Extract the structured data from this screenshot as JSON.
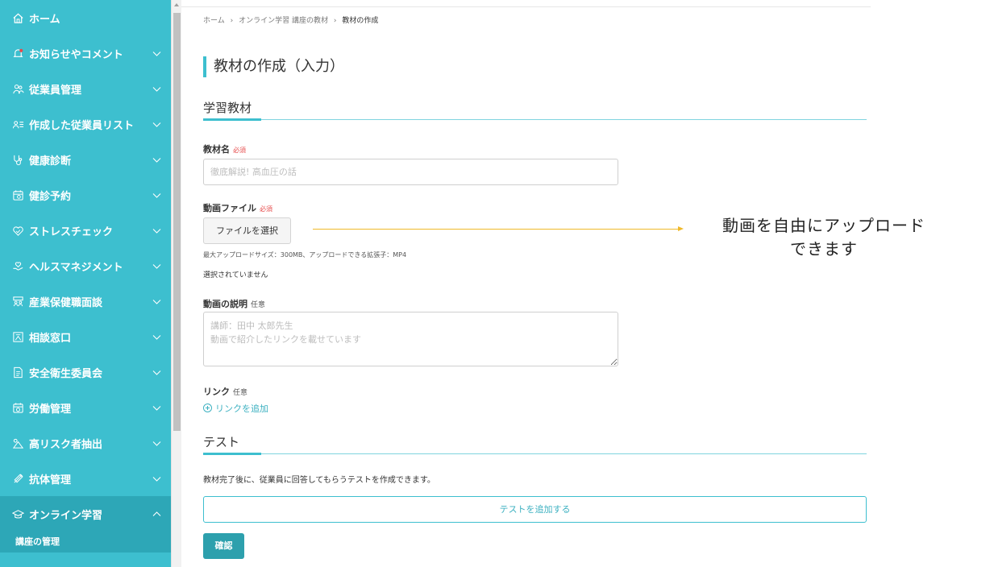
{
  "sidebar": {
    "items": [
      {
        "label": "ホーム",
        "icon": "home-icon"
      },
      {
        "label": "お知らせやコメント",
        "icon": "bell-icon"
      },
      {
        "label": "従業員管理",
        "icon": "people-icon"
      },
      {
        "label": "作成した従業員リスト",
        "icon": "person-list-icon"
      },
      {
        "label": "健康診断",
        "icon": "stethoscope-icon"
      },
      {
        "label": "健診予約",
        "icon": "calendar-icon"
      },
      {
        "label": "ストレスチェック",
        "icon": "heart-check-icon"
      },
      {
        "label": "ヘルスマネジメント",
        "icon": "hand-heart-icon"
      },
      {
        "label": "産業保健職面談",
        "icon": "meeting-icon"
      },
      {
        "label": "相談窓口",
        "icon": "consult-icon"
      },
      {
        "label": "安全衛生委員会",
        "icon": "document-icon"
      },
      {
        "label": "労働管理",
        "icon": "calendar-clock-icon"
      },
      {
        "label": "高リスク者抽出",
        "icon": "risk-icon"
      },
      {
        "label": "抗体管理",
        "icon": "syringe-icon"
      },
      {
        "label": "オンライン学習",
        "icon": "graduation-cap-icon"
      }
    ],
    "sub_item": "講座の管理"
  },
  "breadcrumb": {
    "home": "ホーム",
    "sep": "›",
    "parent": "オンライン学習 講座の教材",
    "current": "教材の作成"
  },
  "page_title": "教材の作成（入力）",
  "section_material": "学習教材",
  "fields": {
    "name_label": "教材名",
    "required": "必須",
    "optional": "任意",
    "name_placeholder": "徹底解説! 高血圧の話",
    "video_label": "動画ファイル",
    "file_button": "ファイルを選択",
    "file_note": "最大アップロードサイズ：300MB、アップロードできる拡張子：MP4",
    "file_status": "選択されていません",
    "desc_label": "動画の説明",
    "desc_placeholder": "講師：田中 太郎先生\n動画で紹介したリンクを載せています",
    "link_label": "リンク",
    "link_add": "リンクを追加"
  },
  "section_test": "テスト",
  "test": {
    "description": "教材完了後に、従業員に回答してもらうテストを作成できます。",
    "add_button": "テストを追加する"
  },
  "confirm_button": "確認",
  "annotation": {
    "line1": "動画を自由にアップロード",
    "line2": "できます"
  },
  "colors": {
    "sidebar": "#3dbfcf",
    "accent": "#2da0ad",
    "annotation_arrow": "#f0b92a",
    "required": "#e64b4b"
  }
}
